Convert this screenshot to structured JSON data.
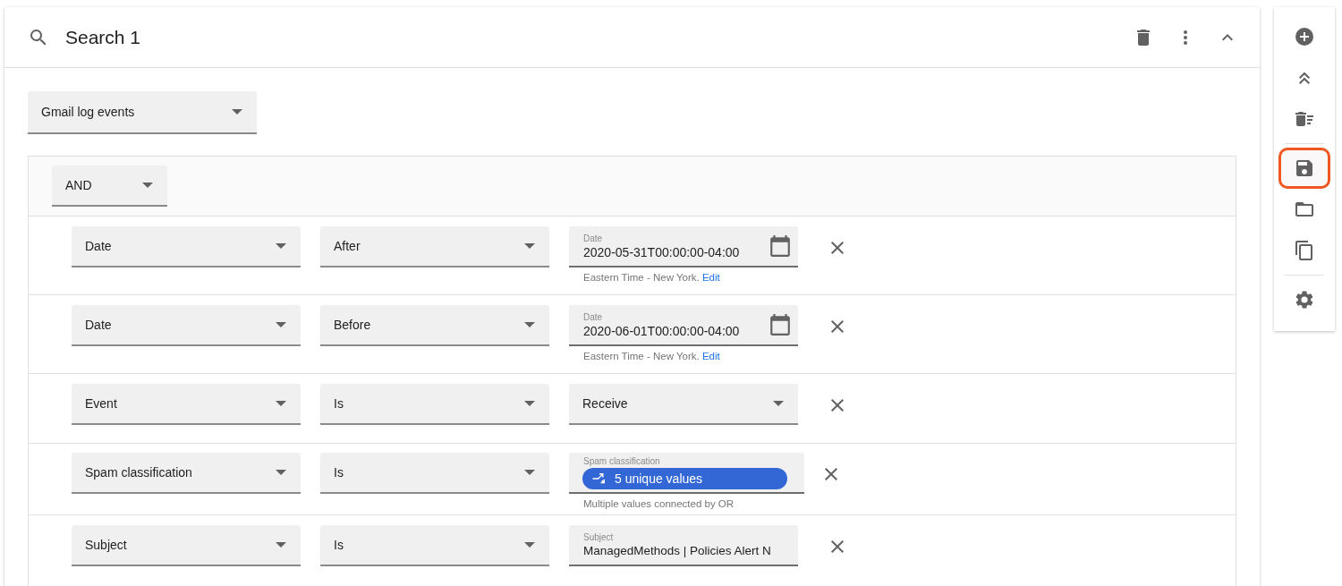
{
  "search": {
    "title": "Search 1"
  },
  "data_source": {
    "value": "Gmail log events"
  },
  "group": {
    "operator": "AND"
  },
  "conditions": [
    {
      "field": "Date",
      "operator": "After",
      "kind": "date",
      "label": "Date",
      "value": "2020-05-31T00:00:00-04:00",
      "helper": "Eastern Time - New York.",
      "helper_link": "Edit"
    },
    {
      "field": "Date",
      "operator": "Before",
      "kind": "date",
      "label": "Date",
      "value": "2020-06-01T00:00:00-04:00",
      "helper": "Eastern Time - New York.",
      "helper_link": "Edit"
    },
    {
      "field": "Event",
      "operator": "Is",
      "kind": "select",
      "value": "Receive"
    },
    {
      "field": "Spam classification",
      "operator": "Is",
      "kind": "chips",
      "label": "Spam classification",
      "value": "5 unique values",
      "helper": "Multiple values connected by OR"
    },
    {
      "field": "Subject",
      "operator": "Is",
      "kind": "text",
      "label": "Subject",
      "value": "ManagedMethods | Policies Alert N"
    }
  ],
  "toolbar": [
    {
      "kind": "add",
      "highlighted": false
    },
    {
      "kind": "collapse",
      "highlighted": false
    },
    {
      "kind": "delete",
      "highlighted": false
    },
    {
      "kind": "save",
      "highlighted": true
    },
    {
      "kind": "folder",
      "highlighted": false
    },
    {
      "kind": "copy",
      "highlighted": false
    },
    {
      "kind": "settings",
      "highlighted": false
    }
  ]
}
